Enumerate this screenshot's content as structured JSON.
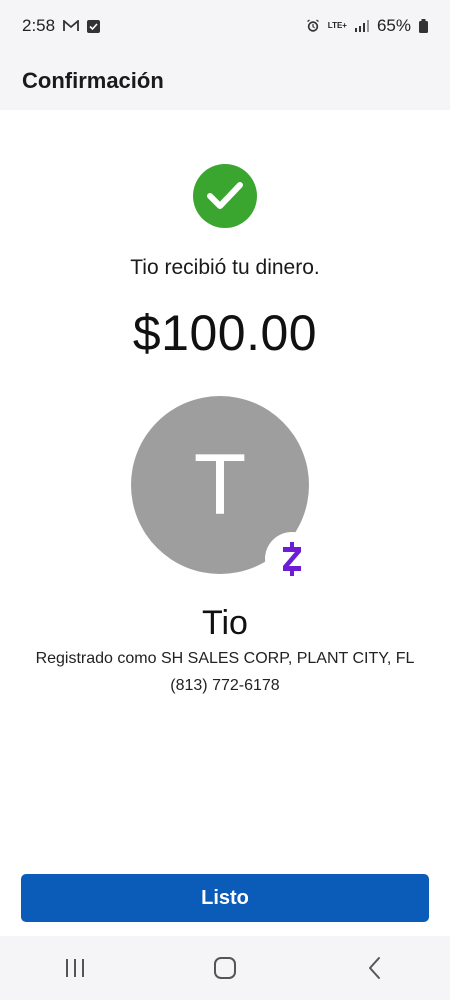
{
  "status_bar": {
    "time": "2:58",
    "network": "LTE+",
    "battery": "65%",
    "icons": [
      "gmail-icon",
      "checkbox-notification-icon",
      "alarm-icon",
      "signal-icon",
      "battery-icon"
    ]
  },
  "header": {
    "title": "Confirmación"
  },
  "confirmation": {
    "message": "Tio recibió tu dinero.",
    "amount": "$100.00",
    "status_color": "#3aa62f"
  },
  "recipient": {
    "initial": "T",
    "name": "Tio",
    "registered": "Registrado como SH SALES CORP, PLANT CITY, FL",
    "phone": "(813) 772-6178",
    "badge_icon": "zelle-icon",
    "badge_color": "#6d1ed4"
  },
  "actions": {
    "done_label": "Listo",
    "button_color": "#0b5cb8"
  },
  "nav": {
    "icons": [
      "recent-apps-icon",
      "home-icon",
      "back-icon"
    ]
  }
}
